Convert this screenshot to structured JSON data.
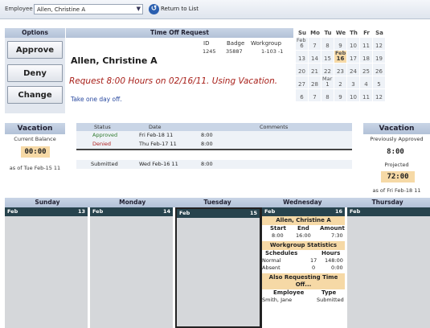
{
  "topbar": {
    "employee_label": "Employee",
    "employee_value": "Allen, Christine A",
    "return_label": "Return to List"
  },
  "options": {
    "header": "Options",
    "approve": "Approve",
    "deny": "Deny",
    "change": "Change"
  },
  "request": {
    "header": "Time Off Request",
    "col_id": "ID",
    "col_badge": "Badge",
    "col_workgroup": "Workgroup",
    "id": "1245",
    "badge": "35887",
    "workgroup": "1-103 -1",
    "employee_name": "Allen, Christine A",
    "text": "Request 8:00 Hours on 02/16/11. Using Vacation.",
    "note": "Take one day off."
  },
  "calendar": {
    "days": [
      "Su",
      "Mo",
      "Tu",
      "We",
      "Th",
      "Fr",
      "Sa"
    ],
    "weeks": [
      [
        {
          "n": "6",
          "m": "Feb"
        },
        {
          "n": "7"
        },
        {
          "n": "8"
        },
        {
          "n": "9"
        },
        {
          "n": "10"
        },
        {
          "n": "11"
        },
        {
          "n": "12"
        }
      ],
      [
        {
          "n": "13"
        },
        {
          "n": "14"
        },
        {
          "n": "15"
        },
        {
          "n": "16",
          "m": "Feb",
          "hl": true
        },
        {
          "n": "17"
        },
        {
          "n": "18"
        },
        {
          "n": "19"
        }
      ],
      [
        {
          "n": "20"
        },
        {
          "n": "21"
        },
        {
          "n": "22"
        },
        {
          "n": "23"
        },
        {
          "n": "24"
        },
        {
          "n": "25"
        },
        {
          "n": "26"
        }
      ],
      [
        {
          "n": "27"
        },
        {
          "n": "28"
        },
        {
          "n": "1",
          "m": "Mar"
        },
        {
          "n": "2"
        },
        {
          "n": "3"
        },
        {
          "n": "4"
        },
        {
          "n": "5"
        }
      ],
      [
        {
          "n": "6"
        },
        {
          "n": "7"
        },
        {
          "n": "8"
        },
        {
          "n": "9"
        },
        {
          "n": "10"
        },
        {
          "n": "11"
        },
        {
          "n": "12"
        }
      ]
    ],
    "highlight_color": "#f6d9a6"
  },
  "vacation_left": {
    "header": "Vacation",
    "current_balance_label": "Current Balance",
    "current_balance": "00:00",
    "as_of": "as of Tue Feb-15 11"
  },
  "status_table": {
    "headers": {
      "status": "Status",
      "date": "Date",
      "comments": "Comments"
    },
    "rows": [
      {
        "status": "Approved",
        "date": "Fri Feb-18 11",
        "hours": "8:00"
      },
      {
        "status": "Denied",
        "date": "Thu Feb-17 11",
        "hours": "8:00"
      }
    ],
    "submitted": {
      "status": "Submitted",
      "date": "Wed Feb-16 11",
      "hours": "8:00"
    }
  },
  "vacation_right": {
    "header": "Vacation",
    "previously_approved_label": "Previously Approved",
    "previously_approved": "8:00",
    "projected_label": "Projected",
    "projected": "72:00",
    "as_of": "as of Fri Feb-18 11"
  },
  "week": {
    "days": [
      "Sunday",
      "Monday",
      "Tuesday",
      "Wednesday",
      "Thursday"
    ],
    "columns": [
      {
        "month": "Feb",
        "day": "13"
      },
      {
        "month": "Feb",
        "day": "14"
      },
      {
        "month": "Feb",
        "day": "15"
      },
      {
        "month": "Feb",
        "day": "16"
      },
      {
        "month": "Feb",
        "day": ""
      }
    ],
    "wednesday": {
      "name": "Allen, Christine A",
      "start_label": "Start",
      "end_label": "End",
      "amount_label": "Amount",
      "start": "8:00",
      "end": "16:00",
      "amount": "7:30",
      "wg_stats_label": "Workgroup Statistics",
      "schedules_label": "Schedules",
      "hours_label": "Hours",
      "normal_label": "Normal",
      "normal_count": "17",
      "normal_hours": "148:00",
      "absent_label": "Absent",
      "absent_count": "0",
      "absent_hours": "0:00",
      "also_label": "Also Requesting Time Off...",
      "employee_label": "Employee",
      "type_label": "Type",
      "other_employee": "Smith, Jane",
      "other_type": "Submitted"
    }
  }
}
